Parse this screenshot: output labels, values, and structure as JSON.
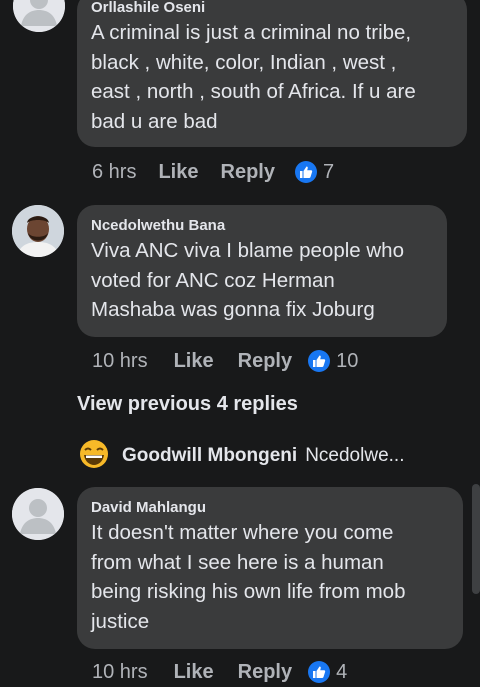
{
  "comments": [
    {
      "author": "Orllashile Oseni",
      "lines": [
        "A criminal is just a criminal no tribe,",
        "black , white, color, Indian , west ,",
        "east , north , south of Africa. If u are",
        "bad u are bad"
      ],
      "time": "6 hrs",
      "like": "Like",
      "reply": "Reply",
      "reactions": "7"
    },
    {
      "author": "Ncedolwethu Bana",
      "lines": [
        "Viva ANC viva I blame people who",
        "voted for ANC  coz Herman",
        "Mashaba was gonna fix Joburg"
      ],
      "time": "10 hrs",
      "like": "Like",
      "reply": "Reply",
      "reactions": "10"
    },
    {
      "author": "David Mahlangu",
      "lines": [
        "It doesn't matter where you come",
        "from what I see here is a human",
        "being risking his own life from mob",
        "justice"
      ],
      "time": "10 hrs",
      "like": "Like",
      "reply": "Reply",
      "reactions": "4"
    }
  ],
  "view_previous": "View previous 4 replies",
  "reply_preview": {
    "author": "Goodwill Mbongeni",
    "snippet": "Ncedolwe..."
  },
  "colors": {
    "background": "#18191a",
    "bubble": "#3a3b3c",
    "text": "#e4e6eb",
    "muted": "#b0b3b8",
    "like_blue": "#1877f2"
  },
  "icons": {
    "reaction": "like-thumb-icon",
    "default_avatar": "default-avatar-icon",
    "emoji": "laughing-emoji-icon"
  }
}
